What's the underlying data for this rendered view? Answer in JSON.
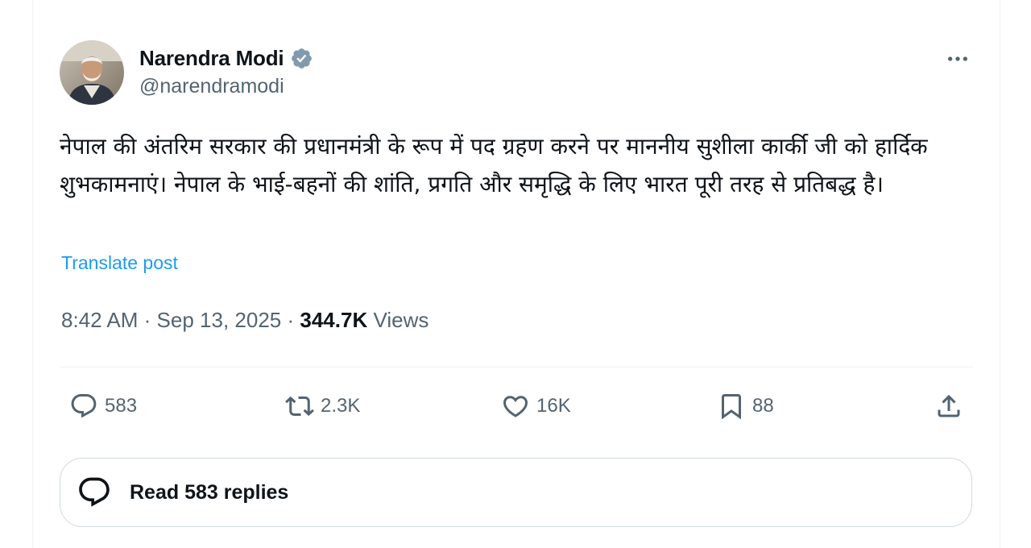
{
  "author": {
    "display_name": "Narendra Modi",
    "handle": "@narendramodi",
    "verified": true,
    "verified_color": "#829aab"
  },
  "post": {
    "text": "नेपाल की अंतरिम सरकार की प्रधानमंत्री के रूप में पद ग्रहण करने पर माननीय सुशीला कार्की जी को हार्दिक शुभकामनाएं। नेपाल के भाई-बहनों की शांति, प्रगति और समृद्धि के लिए भारत पूरी तरह से प्रतिबद्ध है।",
    "translate_label": "Translate post",
    "time": "8:42 AM",
    "separator": "·",
    "date": "Sep 13, 2025",
    "views_count": "344.7K",
    "views_label": "Views"
  },
  "actions": {
    "replies": "583",
    "reposts": "2.3K",
    "likes": "16K",
    "bookmarks": "88"
  },
  "replies_button": {
    "label": "Read 583 replies"
  },
  "colors": {
    "text_primary": "#0f1419",
    "text_secondary": "#536471",
    "link": "#1d9bf0",
    "border": "#cfd9de"
  }
}
